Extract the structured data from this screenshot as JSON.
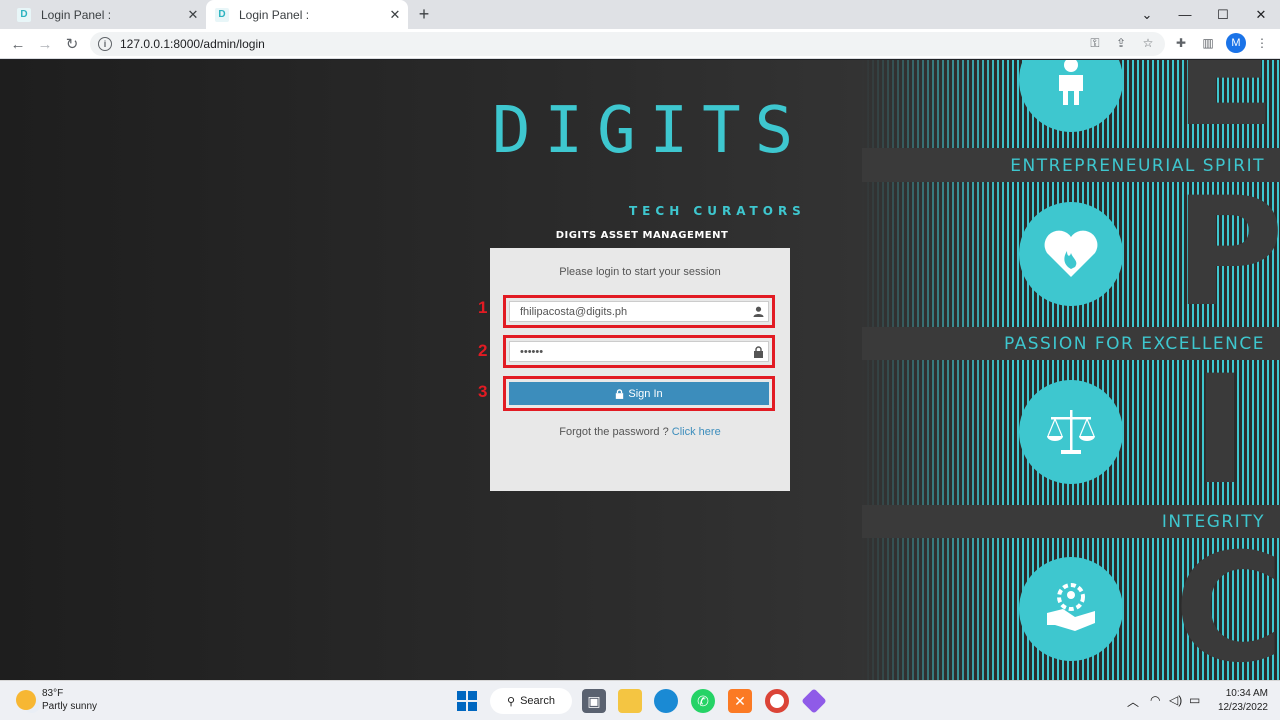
{
  "browser": {
    "tabs": [
      {
        "title": "Login Panel :",
        "favicon": "D"
      },
      {
        "title": "Login Panel :",
        "favicon": "D"
      }
    ],
    "new_tab": "+",
    "url": "127.0.0.1:8000/admin/login",
    "profile_initial": "M"
  },
  "page": {
    "logo_main": "DIGITS",
    "logo_sub": "TECH CURATORS",
    "app_name": "DIGITS ASSET MANAGEMENT",
    "login": {
      "message": "Please login to start your session",
      "email_value": "fhilipacosta@digits.ph",
      "password_value": "••••••",
      "sign_in_label": "Sign In",
      "forgot_text": "Forgot the password ?",
      "forgot_link": "Click here",
      "annotations": [
        "1",
        "2",
        "3"
      ]
    },
    "epic": {
      "letters": [
        "E",
        "P",
        "I",
        "C"
      ],
      "labels": [
        "ENTREPRENEURIAL SPIRIT",
        "PASSION FOR EXCELLENCE",
        "INTEGRITY"
      ]
    }
  },
  "taskbar": {
    "temperature": "83°F",
    "weather": "Partly sunny",
    "search_label": "Search",
    "time": "10:34 AM",
    "date": "12/23/2022"
  },
  "colors": {
    "brand_teal": "#3ec7cf",
    "annotation_red": "#e21b23",
    "button_blue": "#3c8dbc"
  }
}
